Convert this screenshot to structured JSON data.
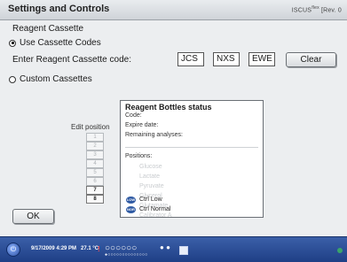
{
  "window": {
    "title": "Settings and Controls",
    "brand": "ISCUS",
    "brand_sup": "flex",
    "brand_rev": "[Rev. 0"
  },
  "section": {
    "title": "Reagent Cassette"
  },
  "options": {
    "use_codes": "Use Cassette Codes",
    "custom": "Custom Cassettes"
  },
  "code": {
    "label": "Enter Reagent Cassette code:",
    "inputs": [
      "JCS",
      "NXS",
      "EWE"
    ]
  },
  "buttons": {
    "clear": "Clear",
    "ok": "OK"
  },
  "status": {
    "title": "Reagent Bottles status",
    "code": "Code:",
    "expire": "Expire date:",
    "remaining": "Remaining analyses:",
    "positions_label": "Positions:",
    "positions": [
      "Glucose",
      "Lactate",
      "Pyruvate",
      "Glycerol",
      "Glutamate",
      "Calibrator A"
    ],
    "controls": [
      {
        "icon": "LOW",
        "label": "Ctrl Low"
      },
      {
        "icon": "NOR",
        "label": "Ctrl Normal"
      }
    ]
  },
  "edit": {
    "label": "Edit position",
    "positions": [
      "1",
      "2",
      "3",
      "4",
      "5",
      "6",
      "7",
      "8"
    ]
  },
  "taskbar": {
    "date": "9/17/2009 4:29 PM",
    "temp": "27.1 °C",
    "alert": "!",
    "circles": "○○○○○○",
    "dots": "●○○○○○○○○○○○○○○"
  },
  "icons": {
    "radio-selected": "radio-selected-icon",
    "radio-unselected": "radio-icon",
    "power": "power-icon",
    "ctrl": "control-sample-icon"
  }
}
